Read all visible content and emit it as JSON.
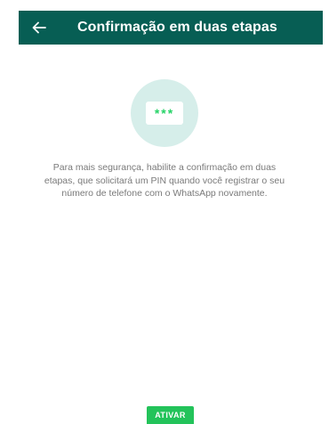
{
  "header": {
    "title": "Confirmação em duas etapas",
    "back_icon": "arrow-left-icon",
    "background": "#075E54"
  },
  "illustration": {
    "pin_mask": "***",
    "circle_color": "#D6EEEA",
    "accent_color": "#25D366"
  },
  "description": "Para mais segurança, habilite a confirmação em duas etapas, que solicitará um PIN quando você registrar o seu número de telefone com o WhatsApp novamente.",
  "actions": {
    "activate_label": "ATIVAR",
    "activate_color": "#23C35A"
  }
}
